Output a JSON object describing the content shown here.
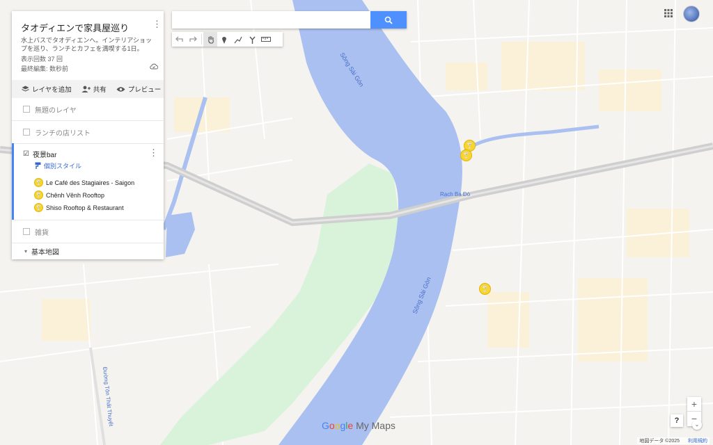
{
  "map": {
    "river_labels": [
      "Sông Sài Gòn",
      "Sông Sài Gòn"
    ],
    "canal_label": "Rạch Ba Đò",
    "street_label": "Đường Tôn Thất Thuyết",
    "colors": {
      "land": "#f5f3ef",
      "water": "#aac0f0",
      "park": "#d9f3da",
      "road": "#ffffff",
      "highway": "#cfcfcf",
      "built": "#fbf0d8"
    }
  },
  "search": {
    "value": "",
    "placeholder": "",
    "button_icon": "search-icon"
  },
  "tools": [
    "undo-icon",
    "redo-icon",
    "hand-icon",
    "marker-icon",
    "draw-line-icon",
    "directions-icon",
    "ruler-icon"
  ],
  "panel": {
    "title": "タオディエンで家具屋巡り",
    "description": "水上バスでタオディエンへ。インテリアショップを巡り、ランチとカフェを満喫する1日。",
    "views": "表示回数 37 回",
    "last_edit": "最終編集: 数秒前",
    "toolbar": {
      "add_layer": "レイヤを追加",
      "share": "共有",
      "preview": "プレビュー"
    },
    "layers": [
      {
        "name": "無題のレイヤ"
      },
      {
        "name": "ランチの店リスト"
      }
    ],
    "active_layer": {
      "name": "夜景bar",
      "style_link": "個別スタイル",
      "places": [
        "Le Café des Stagiaires - Saigon",
        "Chênh Vênh Rooftop",
        "Shiso Rooftop & Restaurant"
      ]
    },
    "layer_misc": {
      "name": "雑貨"
    },
    "base_map": "基本地図"
  },
  "brand": {
    "google": "Google",
    "mymaps": "My Maps"
  },
  "controls": {
    "zoom_in": "+",
    "zoom_out": "−",
    "help": "?"
  },
  "footer": {
    "attribution": "地図データ ©2025",
    "terms": "利用規約"
  }
}
